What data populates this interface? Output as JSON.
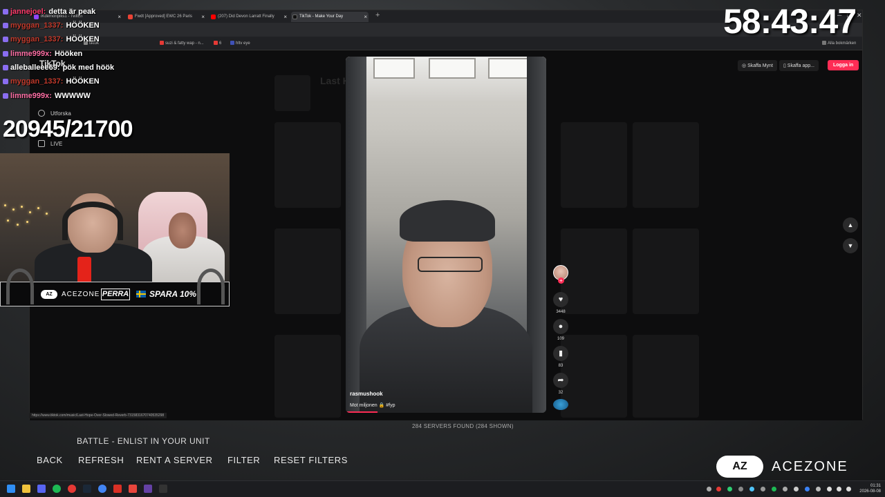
{
  "browser": {
    "tabs": [
      {
        "label": "iKdemonpiks1 - Twitch",
        "color": "#9146ff",
        "active": false
      },
      {
        "label": "Fwdt [Approved] EWC 26 Paris",
        "color": "#ea4335",
        "active": false
      },
      {
        "label": "(207) Did Devon Larratt Finally",
        "color": "#ff0000",
        "active": false
      },
      {
        "label": "TikTok - Make Your Day",
        "color": "#111111",
        "active": true
      }
    ],
    "new_tab": "+",
    "bookmarks": [
      {
        "label": "tiktok",
        "color": "#888888"
      },
      {
        "label": "suzi & fatty wap - n...",
        "color": "#e53935"
      },
      {
        "label": "6",
        "color": "#e53935"
      },
      {
        "label": "hltv eye",
        "color": "#3f51b5"
      }
    ],
    "all_bookmarks": "Alla bokmärken",
    "status_url": "https://www.tiktok.com/music/Last-Hope-Over-Slowed-Reverb-7315831670740535298"
  },
  "tiktok": {
    "logo": "TikTok",
    "sidebar": [
      {
        "label": "Utforska"
      },
      {
        "label": "LIVE"
      }
    ],
    "background_title": "Last Hope (Over Slowed + Reverb)",
    "buttons": {
      "coins": "Skaffa Mynt",
      "app": "Skaffa app...",
      "login": "Logga in"
    },
    "video": {
      "handle": "rasmushook",
      "caption": "Mot miljonen 🔒 #fyp",
      "progress": 0.16
    },
    "rail": {
      "likes": "3448",
      "comments": "109",
      "saves": "83",
      "shares": "32"
    }
  },
  "game": {
    "servers_found": "284 SERVERS FOUND (284 SHOWN)",
    "battle_text": "BATTLE - ENLIST IN YOUR UNIT",
    "battle_prefix": "",
    "menu": [
      "BACK",
      "REFRESH",
      "RENT A SERVER",
      "FILTER",
      "RESET FILTERS"
    ]
  },
  "overlay": {
    "chat": [
      {
        "user": "jannejoel:",
        "message": "detta är peak",
        "user_color": "#ff3b6b"
      },
      {
        "user": "myggan_1337:",
        "message": "HÖÖKEN",
        "user_color": "#c0392b"
      },
      {
        "user": "myggan_1337:",
        "message": "HÖÖKEN",
        "user_color": "#c0392b"
      },
      {
        "user": "limme999x:",
        "message": "Hööken",
        "user_color": "#ff6fa5"
      },
      {
        "user": "alleballeee69:",
        "message": "pök med höök",
        "user_color": "#ffffff"
      },
      {
        "user": "myggan_1337:",
        "message": "HÖÖKEN",
        "user_color": "#c0392b"
      },
      {
        "user": "limme999x:",
        "message": "WWWWW",
        "user_color": "#ff6fa5"
      }
    ],
    "counter": "20945/21700",
    "timer": "58:43:47",
    "sponsor": {
      "logo": "AZ",
      "brand": "ACEZONE",
      "code": "PERRA",
      "save": "SPARA 10%"
    },
    "brand_logo": "AZ",
    "brand_word": "ACEZONE"
  },
  "taskbar": {
    "time": "01:31",
    "date": "2026-08-08"
  }
}
